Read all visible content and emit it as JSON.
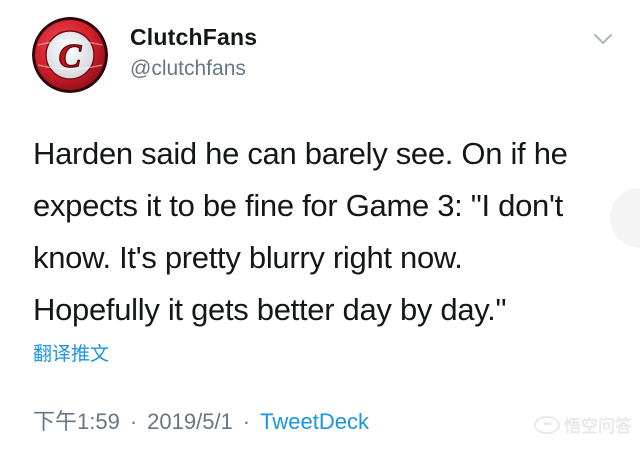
{
  "account": {
    "display_name": "ClutchFans",
    "handle": "@clutchfans",
    "avatar_letter": "C"
  },
  "tweet": {
    "text": "Harden said he can barely see. On if he\nexpects it to be fine for Game 3: \"I don't\nknow. It's pretty blurry right now.\nHopefully it gets better day by day.\"",
    "translate_label": "翻译推文",
    "time": "下午1:59",
    "date": "2019/5/1",
    "separator": "·",
    "source": "TweetDeck"
  },
  "watermark": {
    "text": "悟空问答"
  },
  "icons": {
    "menu": "chevron-down-icon"
  },
  "colors": {
    "link": "#1b95e0",
    "muted": "#657786",
    "text": "#14171a",
    "avatar_red": "#d21f2b"
  }
}
